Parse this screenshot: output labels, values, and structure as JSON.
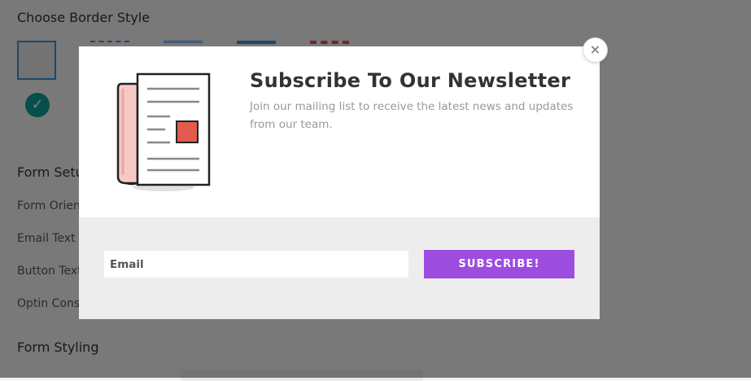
{
  "settings": {
    "border_style_heading": "Choose Border Style",
    "form_setup_heading": "Form Setu",
    "form_orientation_label": "Form Orien",
    "email_text_label": "Email Text",
    "button_text_label": "Button Text",
    "optin_consent_label": "Optin Conse",
    "form_styling_heading": "Form Styling",
    "selected_check_icon": "check-icon",
    "accent_color": "#0f9e94"
  },
  "modal": {
    "title": "Subscribe To Our Newsletter",
    "description": "Join our mailing list to receive the latest news and updates from our team.",
    "email_placeholder": "Email",
    "subscribe_label": "SUBSCRIBE!",
    "close_symbol": "×",
    "illustration_icon": "newspaper-icon",
    "button_color": "#9c4de0"
  }
}
